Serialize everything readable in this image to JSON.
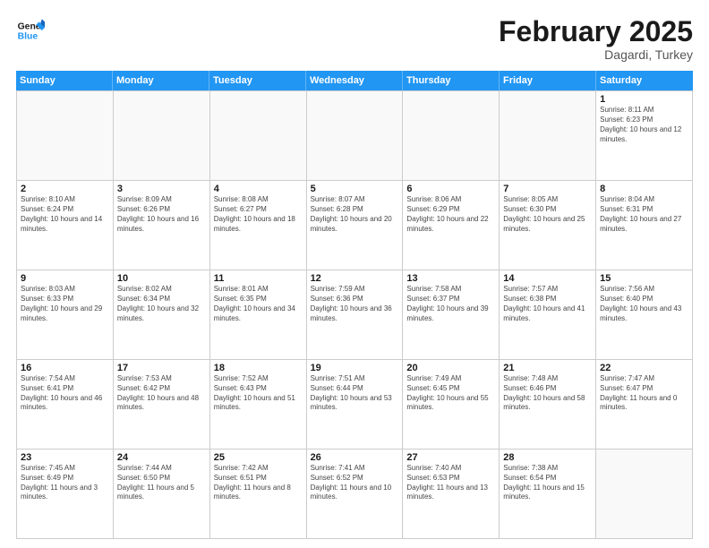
{
  "header": {
    "logo_general": "General",
    "logo_blue": "Blue",
    "title": "February 2025",
    "location": "Dagardi, Turkey"
  },
  "weekdays": [
    "Sunday",
    "Monday",
    "Tuesday",
    "Wednesday",
    "Thursday",
    "Friday",
    "Saturday"
  ],
  "weeks": [
    [
      {
        "day": "",
        "info": ""
      },
      {
        "day": "",
        "info": ""
      },
      {
        "day": "",
        "info": ""
      },
      {
        "day": "",
        "info": ""
      },
      {
        "day": "",
        "info": ""
      },
      {
        "day": "",
        "info": ""
      },
      {
        "day": "1",
        "info": "Sunrise: 8:11 AM\nSunset: 6:23 PM\nDaylight: 10 hours and 12 minutes."
      }
    ],
    [
      {
        "day": "2",
        "info": "Sunrise: 8:10 AM\nSunset: 6:24 PM\nDaylight: 10 hours and 14 minutes."
      },
      {
        "day": "3",
        "info": "Sunrise: 8:09 AM\nSunset: 6:26 PM\nDaylight: 10 hours and 16 minutes."
      },
      {
        "day": "4",
        "info": "Sunrise: 8:08 AM\nSunset: 6:27 PM\nDaylight: 10 hours and 18 minutes."
      },
      {
        "day": "5",
        "info": "Sunrise: 8:07 AM\nSunset: 6:28 PM\nDaylight: 10 hours and 20 minutes."
      },
      {
        "day": "6",
        "info": "Sunrise: 8:06 AM\nSunset: 6:29 PM\nDaylight: 10 hours and 22 minutes."
      },
      {
        "day": "7",
        "info": "Sunrise: 8:05 AM\nSunset: 6:30 PM\nDaylight: 10 hours and 25 minutes."
      },
      {
        "day": "8",
        "info": "Sunrise: 8:04 AM\nSunset: 6:31 PM\nDaylight: 10 hours and 27 minutes."
      }
    ],
    [
      {
        "day": "9",
        "info": "Sunrise: 8:03 AM\nSunset: 6:33 PM\nDaylight: 10 hours and 29 minutes."
      },
      {
        "day": "10",
        "info": "Sunrise: 8:02 AM\nSunset: 6:34 PM\nDaylight: 10 hours and 32 minutes."
      },
      {
        "day": "11",
        "info": "Sunrise: 8:01 AM\nSunset: 6:35 PM\nDaylight: 10 hours and 34 minutes."
      },
      {
        "day": "12",
        "info": "Sunrise: 7:59 AM\nSunset: 6:36 PM\nDaylight: 10 hours and 36 minutes."
      },
      {
        "day": "13",
        "info": "Sunrise: 7:58 AM\nSunset: 6:37 PM\nDaylight: 10 hours and 39 minutes."
      },
      {
        "day": "14",
        "info": "Sunrise: 7:57 AM\nSunset: 6:38 PM\nDaylight: 10 hours and 41 minutes."
      },
      {
        "day": "15",
        "info": "Sunrise: 7:56 AM\nSunset: 6:40 PM\nDaylight: 10 hours and 43 minutes."
      }
    ],
    [
      {
        "day": "16",
        "info": "Sunrise: 7:54 AM\nSunset: 6:41 PM\nDaylight: 10 hours and 46 minutes."
      },
      {
        "day": "17",
        "info": "Sunrise: 7:53 AM\nSunset: 6:42 PM\nDaylight: 10 hours and 48 minutes."
      },
      {
        "day": "18",
        "info": "Sunrise: 7:52 AM\nSunset: 6:43 PM\nDaylight: 10 hours and 51 minutes."
      },
      {
        "day": "19",
        "info": "Sunrise: 7:51 AM\nSunset: 6:44 PM\nDaylight: 10 hours and 53 minutes."
      },
      {
        "day": "20",
        "info": "Sunrise: 7:49 AM\nSunset: 6:45 PM\nDaylight: 10 hours and 55 minutes."
      },
      {
        "day": "21",
        "info": "Sunrise: 7:48 AM\nSunset: 6:46 PM\nDaylight: 10 hours and 58 minutes."
      },
      {
        "day": "22",
        "info": "Sunrise: 7:47 AM\nSunset: 6:47 PM\nDaylight: 11 hours and 0 minutes."
      }
    ],
    [
      {
        "day": "23",
        "info": "Sunrise: 7:45 AM\nSunset: 6:49 PM\nDaylight: 11 hours and 3 minutes."
      },
      {
        "day": "24",
        "info": "Sunrise: 7:44 AM\nSunset: 6:50 PM\nDaylight: 11 hours and 5 minutes."
      },
      {
        "day": "25",
        "info": "Sunrise: 7:42 AM\nSunset: 6:51 PM\nDaylight: 11 hours and 8 minutes."
      },
      {
        "day": "26",
        "info": "Sunrise: 7:41 AM\nSunset: 6:52 PM\nDaylight: 11 hours and 10 minutes."
      },
      {
        "day": "27",
        "info": "Sunrise: 7:40 AM\nSunset: 6:53 PM\nDaylight: 11 hours and 13 minutes."
      },
      {
        "day": "28",
        "info": "Sunrise: 7:38 AM\nSunset: 6:54 PM\nDaylight: 11 hours and 15 minutes."
      },
      {
        "day": "",
        "info": ""
      }
    ]
  ]
}
